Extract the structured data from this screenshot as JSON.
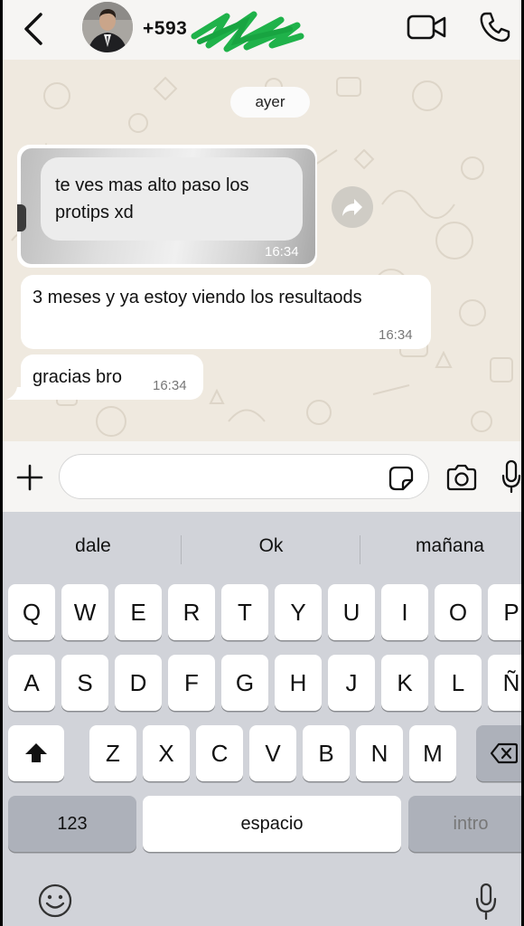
{
  "header": {
    "contact_name": "+593",
    "icons": [
      "back-chevron-icon",
      "avatar",
      "video-call-icon",
      "phone-call-icon"
    ]
  },
  "chat": {
    "date_label": "ayer",
    "messages": [
      {
        "text": "te ves mas alto paso los protips xd",
        "time": "16:34",
        "type": "forwarded-quote"
      },
      {
        "text": "3 meses y ya estoy viendo los resultaods",
        "time": "16:34"
      },
      {
        "text": "gracias bro",
        "time": "16:34"
      }
    ]
  },
  "input": {
    "value": "",
    "placeholder": ""
  },
  "keyboard": {
    "suggestions": [
      "dale",
      "Ok",
      "mañana"
    ],
    "row1": [
      "Q",
      "W",
      "E",
      "R",
      "T",
      "Y",
      "U",
      "I",
      "O",
      "P"
    ],
    "row2": [
      "A",
      "S",
      "D",
      "F",
      "G",
      "H",
      "J",
      "K",
      "L",
      "Ñ"
    ],
    "row3": [
      "Z",
      "X",
      "C",
      "V",
      "B",
      "N",
      "M"
    ],
    "numbers_label": "123",
    "space_label": "espacio",
    "return_label": "intro"
  },
  "colors": {
    "chat_background": "#efe9df",
    "bubble": "#ffffff",
    "keyboard_background": "#d1d3d9",
    "redaction_scribble": "#1fb24a"
  }
}
